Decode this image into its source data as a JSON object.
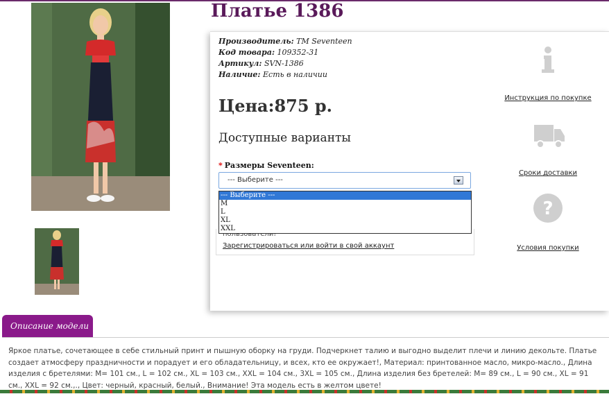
{
  "product": {
    "title": "Платье 1386",
    "meta": [
      {
        "label": "Производитель:",
        "value": "TM Seventeen"
      },
      {
        "label": "Код товара:",
        "value": "109352-31"
      },
      {
        "label": "Артикул:",
        "value": "SVN-1386"
      },
      {
        "label": "Наличие:",
        "value": "Есть в наличии"
      }
    ],
    "price": "Цена:875 р.",
    "options_heading": "Доступные варианты",
    "size_label": "Размеры Seventeen:",
    "required_mark": "*",
    "size_select": {
      "selected": "--- Выберите ---",
      "options": [
        "--- Выберите ---",
        "M",
        "L",
        "XL",
        "XXL"
      ]
    },
    "login_notice": "пользователи!",
    "login_link": "Зарегистрироваться или войти в свой аккаунт"
  },
  "side_links": {
    "instruction": "Инструкция по покупке",
    "delivery": "Сроки доставки",
    "terms": "Условия покупки"
  },
  "description": {
    "tab_label": "Описание модели",
    "text": "Яркое платье, сочетающее в себе стильный принт и пышную оборку на груди. Подчеркнет талию и выгодно выделит плечи и линию декольте. Платье создает атмосферу праздничности и порадует и его обладательницу, и всех, кто ее окружает!, Материал: принтованное масло, микро-масло., Длина изделия с бретелями: M= 101 см., L = 102 см., XL = 103 см., XXL = 104 см., 3XL = 105 см., Длина изделия без бретелей: M= 89 см., L = 90 см., XL = 91 см., XXL = 92 см.,., Цвет: черный, красный, белый., Внимание! Эта модель есть в желтом цвете!"
  },
  "colors": {
    "title": "#5a1a5a",
    "tab": "#8a1a8a",
    "select_highlight": "#3178d6"
  }
}
